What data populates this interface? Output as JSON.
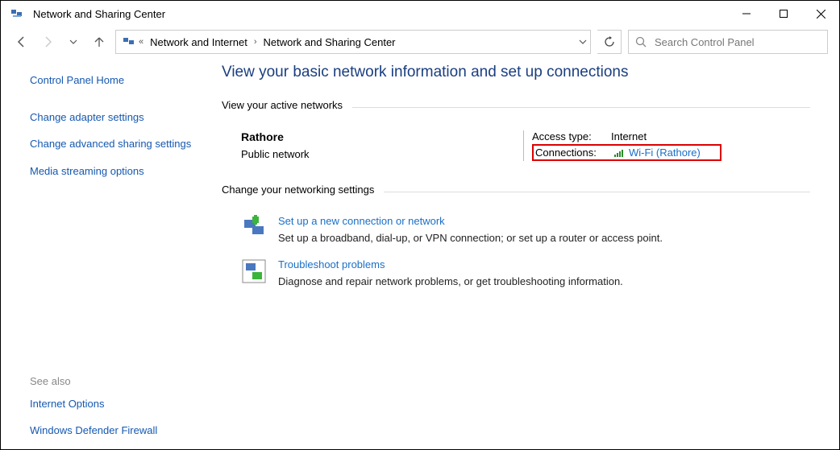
{
  "window": {
    "title": "Network and Sharing Center"
  },
  "breadcrumb": {
    "level1": "Network and Internet",
    "level2": "Network and Sharing Center"
  },
  "search": {
    "placeholder": "Search Control Panel"
  },
  "sidebar": {
    "home": "Control Panel Home",
    "links": [
      "Change adapter settings",
      "Change advanced sharing settings",
      "Media streaming options"
    ],
    "see_also_label": "See also",
    "see_also": [
      "Internet Options",
      "Windows Defender Firewall"
    ]
  },
  "main": {
    "heading": "View your basic network information and set up connections",
    "active_label": "View your active networks",
    "network": {
      "name": "Rathore",
      "type": "Public network",
      "access_label": "Access type:",
      "access_value": "Internet",
      "connections_label": "Connections:",
      "connection_link": "Wi-Fi (Rathore)"
    },
    "change_label": "Change your networking settings",
    "settings": [
      {
        "title": "Set up a new connection or network",
        "desc": "Set up a broadband, dial-up, or VPN connection; or set up a router or access point."
      },
      {
        "title": "Troubleshoot problems",
        "desc": "Diagnose and repair network problems, or get troubleshooting information."
      }
    ]
  }
}
